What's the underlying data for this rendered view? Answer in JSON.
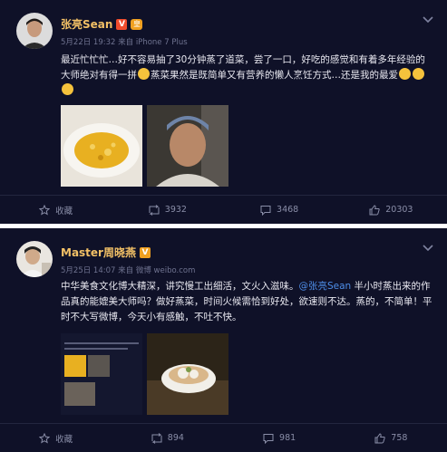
{
  "post1": {
    "author": "张亮Sean",
    "verified_badge": "V",
    "crown_badge": "皇",
    "meta": "5月22日 19:32 来自 iPhone 7 Plus",
    "text_1": "最近忙忙忙…好不容易抽了30分钟蒸了道菜，尝了一口，好吃的感觉和有着多年经验的大师绝对有得一拼",
    "text_2": "蒸菜果然是既简单又有营养的懒人烹饪方式…还是我的最爱",
    "actions": {
      "favorite_label": "收藏",
      "repost_count": "3932",
      "comment_count": "3468",
      "like_count": "20303"
    }
  },
  "post2": {
    "author": "Master周晓燕",
    "verified_badge": "V",
    "meta": "5月25日 14:07 来自 微博 weibo.com",
    "text_1": "中华美食文化博大精深，讲究慢工出细活，文火入滋味。",
    "mention": "@张亮Sean",
    "text_2": " 半小时蒸出来的作品真的能媲美大师吗？做好蒸菜，时间火候需恰到好处，欲速则不达。蒸的，不简单！平时不大写微博，今天小有感触，不吐不快。",
    "actions": {
      "favorite_label": "收藏",
      "repost_count": "894",
      "comment_count": "981",
      "like_count": "758"
    }
  },
  "colors": {
    "card_bg": "#0f1128",
    "name": "#f2c066",
    "mention": "#4e8ee8",
    "meta": "#6f7390"
  },
  "icons": [
    "avatar",
    "vip-badge-icon",
    "crown-badge-icon",
    "chevron-down-icon",
    "star-icon",
    "repost-icon",
    "comment-icon",
    "like-icon",
    "smile-emoji-icon"
  ]
}
